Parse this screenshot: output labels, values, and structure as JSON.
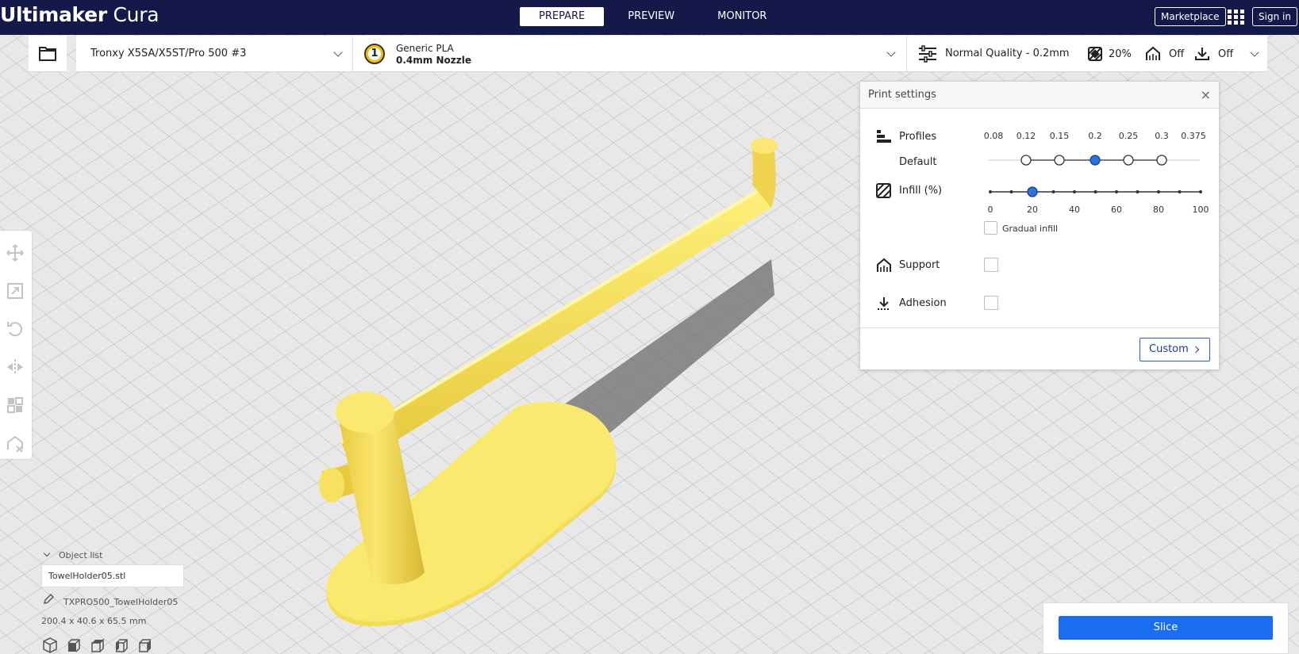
{
  "header": {
    "logo_bold": "Ultimaker",
    "logo_light": "Cura",
    "stages": [
      {
        "label": "PREPARE",
        "active": true
      },
      {
        "label": "PREVIEW",
        "active": false
      },
      {
        "label": "MONITOR",
        "active": false
      }
    ],
    "marketplace_label": "Marketplace",
    "signin_label": "Sign in"
  },
  "toolbar": {
    "printer_name": "Tronxy X5SA/X5ST/Pro 500 #3",
    "extruder_number": "1",
    "material_name": "Generic PLA",
    "nozzle": "0.4mm Nozzle",
    "quality": "Normal Quality - 0.2mm",
    "infill_summary": "20%",
    "support_summary": "Off",
    "adhesion_summary": "Off"
  },
  "print_settings": {
    "title": "Print settings",
    "close_glyph": "×",
    "profiles_label": "Profiles",
    "profile_default_label": "Default",
    "layer_heights": [
      "0.08",
      "0.12",
      "0.15",
      "0.2",
      "0.25",
      "0.3",
      "0.375"
    ],
    "available_layer_heights": [
      "0.12",
      "0.15",
      "0.2",
      "0.25",
      "0.3"
    ],
    "selected_layer_height": "0.2",
    "infill_label": "Infill (%)",
    "infill_ticks": [
      "0",
      "20",
      "40",
      "60",
      "80",
      "100"
    ],
    "infill_value": 20,
    "gradual_infill_label": "Gradual infill",
    "gradual_infill_checked": false,
    "support_label": "Support",
    "support_checked": false,
    "adhesion_label": "Adhesion",
    "adhesion_checked": false,
    "custom_label": "Custom"
  },
  "object_list": {
    "header": "Object list",
    "items": [
      "TowelHolder05.stl"
    ],
    "job_name": "TXPRO500_TowelHolder05",
    "dimensions": "200.4 x 40.6 x 65.5 mm"
  },
  "slice": {
    "label": "Slice",
    "color": "#196ef0"
  },
  "colors": {
    "header_bg": "#15194a",
    "model": "#f8e35c",
    "accent": "#196ef0"
  },
  "icons": {
    "open": "folder-icon",
    "apps": "grid-icon",
    "quality": "sliders-icon",
    "infill": "infill-icon",
    "support": "support-icon",
    "adhesion": "adhesion-icon",
    "tools": [
      "move-icon",
      "scale-icon",
      "rotate-icon",
      "mirror-icon",
      "per-model-settings-icon",
      "support-blocker-icon"
    ],
    "views": [
      "view-3d-icon",
      "view-front-icon",
      "view-top-icon",
      "view-left-icon",
      "view-right-icon"
    ]
  }
}
